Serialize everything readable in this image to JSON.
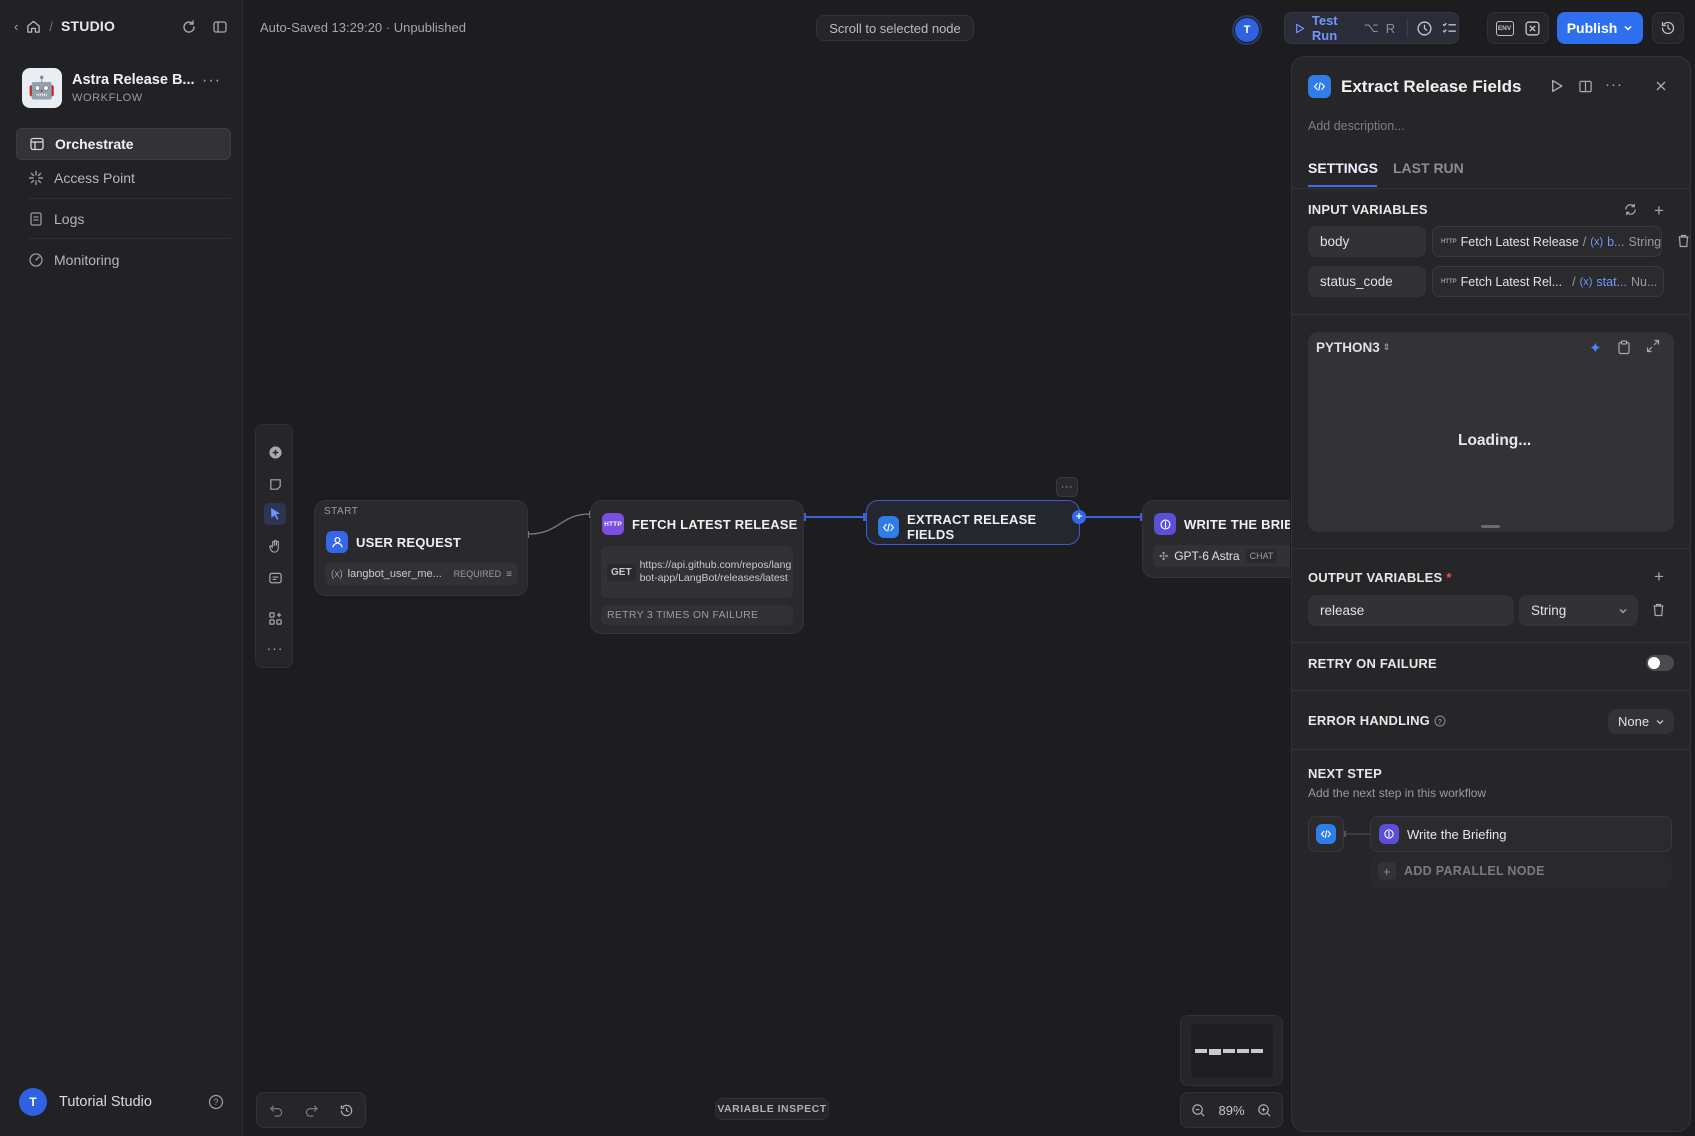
{
  "sidebar": {
    "studio_label": "STUDIO",
    "app": {
      "title": "Astra Release B...",
      "type": "WORKFLOW",
      "icon": "robot-emoji"
    },
    "nav": [
      {
        "label": "Orchestrate",
        "icon": "orchestrate-icon",
        "active": true
      },
      {
        "label": "Access Point",
        "icon": "access-point-icon",
        "active": false
      },
      {
        "label": "Logs",
        "icon": "logs-icon",
        "active": false
      },
      {
        "label": "Monitoring",
        "icon": "monitoring-icon",
        "active": false
      }
    ],
    "user": {
      "initial": "T",
      "name": "Tutorial Studio"
    }
  },
  "topbar": {
    "save_status": "Auto-Saved 13:29:20 · Unpublished",
    "scroll_button": "Scroll to selected node",
    "avatar_initial": "T",
    "test_run": "Test Run",
    "test_run_shortcut_alt": "⌥",
    "test_run_shortcut_key": "R",
    "env_label": "ENV",
    "publish": "Publish",
    "accent_color": "#2e6ff0"
  },
  "canvas": {
    "nodes": {
      "start": {
        "kicker": "START",
        "title": "USER REQUEST",
        "var_name": "langbot_user_me...",
        "var_tag": "REQUIRED"
      },
      "fetch": {
        "icon_label": "HTTP",
        "title": "FETCH LATEST RELEASE",
        "method": "GET",
        "url": "https://api.github.com/repos/langbot-app/LangBot/releases/latest",
        "retry": "RETRY 3 TIMES ON FAILURE"
      },
      "extract": {
        "title": "EXTRACT RELEASE FIELDS"
      },
      "write": {
        "title": "WRITE THE BRIEFIN",
        "model": "GPT-6 Astra",
        "model_tag": "CHAT"
      }
    },
    "variable_inspect": "VARIABLE INSPECT",
    "zoom": "89%"
  },
  "panel": {
    "title": "Extract Release Fields",
    "description_placeholder": "Add description...",
    "tabs": [
      {
        "label": "SETTINGS",
        "active": true
      },
      {
        "label": "LAST RUN",
        "active": false
      }
    ],
    "input_variables": {
      "label": "INPUT VARIABLES",
      "rows": [
        {
          "name": "body",
          "source_node": "Fetch Latest Release",
          "var": "b...",
          "type": "String"
        },
        {
          "name": "status_code",
          "source_node": "Fetch Latest Rel...",
          "var": "stat...",
          "type": "Nu..."
        }
      ],
      "source_badge": "HTTP",
      "var_prefix": "(x)"
    },
    "code": {
      "language": "PYTHON3",
      "loading": "Loading..."
    },
    "output_variables": {
      "label": "OUTPUT VARIABLES",
      "required_mark": "*",
      "rows": [
        {
          "name": "release",
          "type": "String"
        }
      ]
    },
    "retry": {
      "label": "RETRY ON FAILURE",
      "enabled": false
    },
    "error_handling": {
      "label": "ERROR HANDLING",
      "value": "None"
    },
    "next_step": {
      "label": "NEXT STEP",
      "hint": "Add the next step in this workflow",
      "node": "Write the Briefing",
      "add_parallel": "ADD PARALLEL NODE"
    }
  }
}
